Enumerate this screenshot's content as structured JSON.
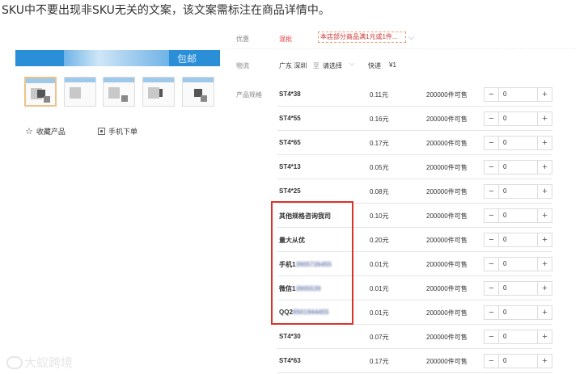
{
  "caption": "SKU中不要出现非SKU无关的文案，该文案需标注在商品详情中。",
  "banner": {
    "text": "包邮"
  },
  "thumbnails": [
    {
      "active": true
    },
    {
      "active": false
    },
    {
      "active": false
    },
    {
      "active": false
    },
    {
      "active": false
    }
  ],
  "side_links": {
    "favorite": "收藏产品",
    "mobile_order": "手机下单"
  },
  "promo": {
    "label": "优惠",
    "tag": "混批",
    "box": "本店部分商品满1元或1件...",
    "chevron": "⌵"
  },
  "shipping": {
    "label": "物流",
    "origin": "广东 深圳",
    "to": "至",
    "dest": "请选择",
    "chevron": "⌵",
    "method": "快递",
    "price": "¥1"
  },
  "spec_label": "产品规格",
  "sku_rows": [
    {
      "name": "ST4*38",
      "price": "0.11元",
      "stock": "200000件可售",
      "qty": "0",
      "blurred": false
    },
    {
      "name": "ST4*55",
      "price": "0.16元",
      "stock": "200000件可售",
      "qty": "0",
      "blurred": false
    },
    {
      "name": "ST4*65",
      "price": "0.17元",
      "stock": "200000件可售",
      "qty": "0",
      "blurred": false
    },
    {
      "name": "ST4*13",
      "price": "0.05元",
      "stock": "200000件可售",
      "qty": "0",
      "blurred": false
    },
    {
      "name": "ST4*25",
      "price": "0.08元",
      "stock": "200000件可售",
      "qty": "0",
      "blurred": false
    },
    {
      "name": "其他规格咨询我司",
      "price": "0.10元",
      "stock": "200000件可售",
      "qty": "0",
      "blurred": false
    },
    {
      "name": "量大从优",
      "price": "0.20元",
      "stock": "200000件可售",
      "qty": "0",
      "blurred": false
    },
    {
      "name": "手机1",
      "blur_tail": "3905726455",
      "price": "0.01元",
      "stock": "200000件可售",
      "qty": "0",
      "blurred": true
    },
    {
      "name": "微信1",
      "blur_tail": "3905539",
      "price": "0.01元",
      "stock": "200000件可售",
      "qty": "0",
      "blurred": true
    },
    {
      "name": "QQ2",
      "blur_tail": "8501944455",
      "price": "0.01元",
      "stock": "200000件可售",
      "qty": "0",
      "blurred": true
    },
    {
      "name": "ST4*30",
      "price": "0.07元",
      "stock": "200000件可售",
      "qty": "0",
      "blurred": false
    },
    {
      "name": "ST4*63",
      "price": "0.17元",
      "stock": "200000件可售",
      "qty": "0",
      "blurred": false
    }
  ],
  "stepper_minus": "−",
  "stepper_plus": "+",
  "watermark": "大蚁跨境",
  "highlight_color": "#d9342b"
}
